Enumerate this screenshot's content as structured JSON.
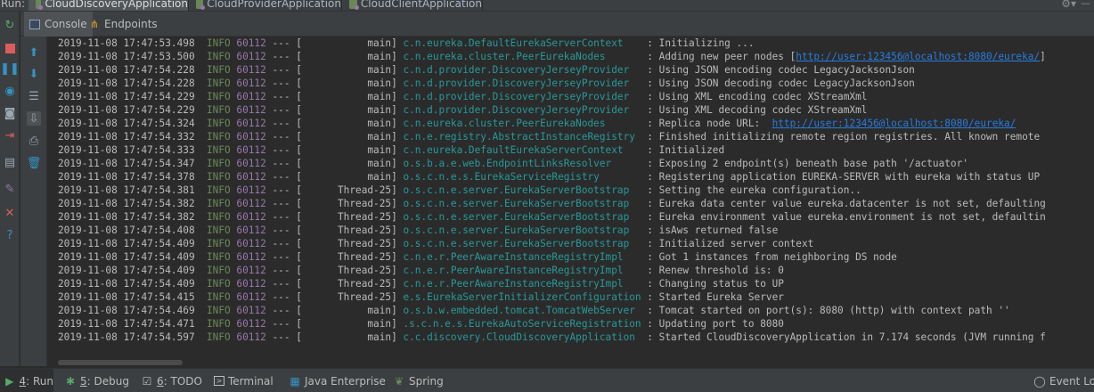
{
  "run_bar": {
    "label": "Run:",
    "tabs": [
      {
        "label": "CloudDiscoveryApplication",
        "active": true
      },
      {
        "label": "CloudProviderApplication",
        "active": false
      },
      {
        "label": "CloudClientApplication",
        "active": false
      }
    ],
    "gear_icon": "gear-icon",
    "hide_icon": "hide-icon"
  },
  "sub_tabs": [
    {
      "label": "Console",
      "icon": "console-icon",
      "active": true
    },
    {
      "label": "Endpoints",
      "icon": "endpoints-icon",
      "active": false
    }
  ],
  "left_toolbar_icons": [
    "rerun-icon",
    "stop-icon",
    "pause-icon",
    "browser-icon",
    "camera-icon",
    "login-icon",
    "layout-icon",
    "pin-icon",
    "close-icon",
    "help-icon"
  ],
  "console_toolbar_icons": [
    "up-arrow-icon",
    "down-arrow-icon",
    "soft-wrap-icon",
    "scroll-to-end-icon",
    "print-icon",
    "trash-icon"
  ],
  "log_lines": [
    {
      "ts": "2019-11-08 17:47:53.498",
      "level": "INFO",
      "pid": "60112",
      "sep": "---",
      "thread": "[           main]",
      "logger": "c.n.eureka.DefaultEurekaServerContext   ",
      "msg": " : Initializing ...",
      "link": ""
    },
    {
      "ts": "2019-11-08 17:47:53.500",
      "level": "INFO",
      "pid": "60112",
      "sep": "---",
      "thread": "[           main]",
      "logger": "c.n.eureka.cluster.PeerEurekaNodes      ",
      "msg": " : Adding new peer nodes [",
      "link": "http://user:123456@localhost:8080/eureka/",
      "post": "]"
    },
    {
      "ts": "2019-11-08 17:47:54.228",
      "level": "INFO",
      "pid": "60112",
      "sep": "---",
      "thread": "[           main]",
      "logger": "c.n.d.provider.DiscoveryJerseyProvider  ",
      "msg": " : Using JSON encoding codec LegacyJacksonJson",
      "link": ""
    },
    {
      "ts": "2019-11-08 17:47:54.228",
      "level": "INFO",
      "pid": "60112",
      "sep": "---",
      "thread": "[           main]",
      "logger": "c.n.d.provider.DiscoveryJerseyProvider  ",
      "msg": " : Using JSON decoding codec LegacyJacksonJson",
      "link": ""
    },
    {
      "ts": "2019-11-08 17:47:54.229",
      "level": "INFO",
      "pid": "60112",
      "sep": "---",
      "thread": "[           main]",
      "logger": "c.n.d.provider.DiscoveryJerseyProvider  ",
      "msg": " : Using XML encoding codec XStreamXml",
      "link": ""
    },
    {
      "ts": "2019-11-08 17:47:54.229",
      "level": "INFO",
      "pid": "60112",
      "sep": "---",
      "thread": "[           main]",
      "logger": "c.n.d.provider.DiscoveryJerseyProvider  ",
      "msg": " : Using XML decoding codec XStreamXml",
      "link": ""
    },
    {
      "ts": "2019-11-08 17:47:54.324",
      "level": "INFO",
      "pid": "60112",
      "sep": "---",
      "thread": "[           main]",
      "logger": "c.n.eureka.cluster.PeerEurekaNodes      ",
      "msg": " : Replica node URL:  ",
      "link": "http://user:123456@localhost:8080/eureka/"
    },
    {
      "ts": "2019-11-08 17:47:54.332",
      "level": "INFO",
      "pid": "60112",
      "sep": "---",
      "thread": "[           main]",
      "logger": "c.n.e.registry.AbstractInstanceRegistry ",
      "msg": " : Finished initializing remote region registries. All known remote",
      "link": ""
    },
    {
      "ts": "2019-11-08 17:47:54.333",
      "level": "INFO",
      "pid": "60112",
      "sep": "---",
      "thread": "[           main]",
      "logger": "c.n.eureka.DefaultEurekaServerContext   ",
      "msg": " : Initialized",
      "link": ""
    },
    {
      "ts": "2019-11-08 17:47:54.347",
      "level": "INFO",
      "pid": "60112",
      "sep": "---",
      "thread": "[           main]",
      "logger": "o.s.b.a.e.web.EndpointLinksResolver     ",
      "msg": " : Exposing 2 endpoint(s) beneath base path '/actuator'",
      "link": ""
    },
    {
      "ts": "2019-11-08 17:47:54.378",
      "level": "INFO",
      "pid": "60112",
      "sep": "---",
      "thread": "[           main]",
      "logger": "o.s.c.n.e.s.EurekaServiceRegistry       ",
      "msg": " : Registering application EUREKA-SERVER with eureka with status UP",
      "link": ""
    },
    {
      "ts": "2019-11-08 17:47:54.381",
      "level": "INFO",
      "pid": "60112",
      "sep": "---",
      "thread": "[      Thread-25]",
      "logger": "o.s.c.n.e.server.EurekaServerBootstrap  ",
      "msg": " : Setting the eureka configuration..",
      "link": ""
    },
    {
      "ts": "2019-11-08 17:47:54.382",
      "level": "INFO",
      "pid": "60112",
      "sep": "---",
      "thread": "[      Thread-25]",
      "logger": "o.s.c.n.e.server.EurekaServerBootstrap  ",
      "msg": " : Eureka data center value eureka.datacenter is not set, defaulting",
      "link": ""
    },
    {
      "ts": "2019-11-08 17:47:54.382",
      "level": "INFO",
      "pid": "60112",
      "sep": "---",
      "thread": "[      Thread-25]",
      "logger": "o.s.c.n.e.server.EurekaServerBootstrap  ",
      "msg": " : Eureka environment value eureka.environment is not set, defaultin",
      "link": ""
    },
    {
      "ts": "2019-11-08 17:47:54.408",
      "level": "INFO",
      "pid": "60112",
      "sep": "---",
      "thread": "[      Thread-25]",
      "logger": "o.s.c.n.e.server.EurekaServerBootstrap  ",
      "msg": " : isAws returned false",
      "link": ""
    },
    {
      "ts": "2019-11-08 17:47:54.409",
      "level": "INFO",
      "pid": "60112",
      "sep": "---",
      "thread": "[      Thread-25]",
      "logger": "o.s.c.n.e.server.EurekaServerBootstrap  ",
      "msg": " : Initialized server context",
      "link": ""
    },
    {
      "ts": "2019-11-08 17:47:54.409",
      "level": "INFO",
      "pid": "60112",
      "sep": "---",
      "thread": "[      Thread-25]",
      "logger": "c.n.e.r.PeerAwareInstanceRegistryImpl   ",
      "msg": " : Got 1 instances from neighboring DS node",
      "link": ""
    },
    {
      "ts": "2019-11-08 17:47:54.409",
      "level": "INFO",
      "pid": "60112",
      "sep": "---",
      "thread": "[      Thread-25]",
      "logger": "c.n.e.r.PeerAwareInstanceRegistryImpl   ",
      "msg": " : Renew threshold is: 0",
      "link": ""
    },
    {
      "ts": "2019-11-08 17:47:54.409",
      "level": "INFO",
      "pid": "60112",
      "sep": "---",
      "thread": "[      Thread-25]",
      "logger": "c.n.e.r.PeerAwareInstanceRegistryImpl   ",
      "msg": " : Changing status to UP",
      "link": ""
    },
    {
      "ts": "2019-11-08 17:47:54.415",
      "level": "INFO",
      "pid": "60112",
      "sep": "---",
      "thread": "[      Thread-25]",
      "logger": "e.s.EurekaServerInitializerConfiguration",
      "msg": " : Started Eureka Server",
      "link": ""
    },
    {
      "ts": "2019-11-08 17:47:54.469",
      "level": "INFO",
      "pid": "60112",
      "sep": "---",
      "thread": "[           main]",
      "logger": "o.s.b.w.embedded.tomcat.TomcatWebServer ",
      "msg": " : Tomcat started on port(s): 8080 (http) with context path ''",
      "link": ""
    },
    {
      "ts": "2019-11-08 17:47:54.471",
      "level": "INFO",
      "pid": "60112",
      "sep": "---",
      "thread": "[           main]",
      "logger": ".s.c.n.e.s.EurekaAutoServiceRegistration",
      "msg": " : Updating port to 8080",
      "link": ""
    },
    {
      "ts": "2019-11-08 17:47:54.597",
      "level": "INFO",
      "pid": "60112",
      "sep": "---",
      "thread": "[           main]",
      "logger": "c.c.discovery.CloudDiscoveryApplication ",
      "msg": " : Started CloudDiscoveryApplication in 7.174 seconds (JVM running f",
      "link": ""
    }
  ],
  "bottom_bar": [
    {
      "mnemonic": "4",
      "label": ": Run",
      "icon": "run-icon",
      "active": true
    },
    {
      "mnemonic": "5",
      "label": ": Debug",
      "icon": "debug-icon",
      "active": false
    },
    {
      "mnemonic": "6",
      "label": ": TODO",
      "icon": "todo-icon",
      "active": false
    },
    {
      "mnemonic": "",
      "label": "Terminal",
      "icon": "terminal-icon",
      "active": false
    },
    {
      "mnemonic": "",
      "label": "Java Enterprise",
      "icon": "java-enterprise-icon",
      "active": false
    },
    {
      "mnemonic": "",
      "label": "Spring",
      "icon": "spring-icon",
      "active": false
    },
    {
      "mnemonic": "",
      "label": "Event Log",
      "icon": "event-log-icon",
      "active": false
    }
  ]
}
